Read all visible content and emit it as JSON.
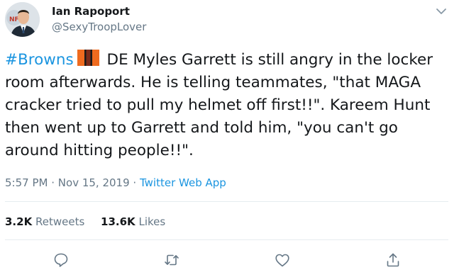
{
  "user": {
    "display_name": "Ian Rapoport",
    "handle": "@SexyTroopLover",
    "avatar_icon": "profile-photo"
  },
  "tweet": {
    "hashtag": "#Browns",
    "flag_icon": "orange-brown-flag-emoji",
    "text": " DE Myles Garrett is still angry in the locker room afterwards. He is telling teammates, \"that MAGA cracker tried to pull my helmet off first!!\". Kareem Hunt then went up to Garrett and told him, \"you can't go around hitting people!!\"."
  },
  "meta": {
    "time": "5:57 PM",
    "sep1": "·",
    "date": "Nov 15, 2019",
    "sep2": "·",
    "app": "Twitter Web App"
  },
  "stats": {
    "retweets_count": "3.2K",
    "retweets_label": "Retweets",
    "likes_count": "13.6K",
    "likes_label": "Likes"
  },
  "actions": [
    "reply-icon",
    "retweet-icon",
    "like-icon",
    "share-icon"
  ],
  "colors": {
    "link": "#1b95e0",
    "secondary": "#657786",
    "primary": "#14171a",
    "divider": "#e6ecf0"
  }
}
